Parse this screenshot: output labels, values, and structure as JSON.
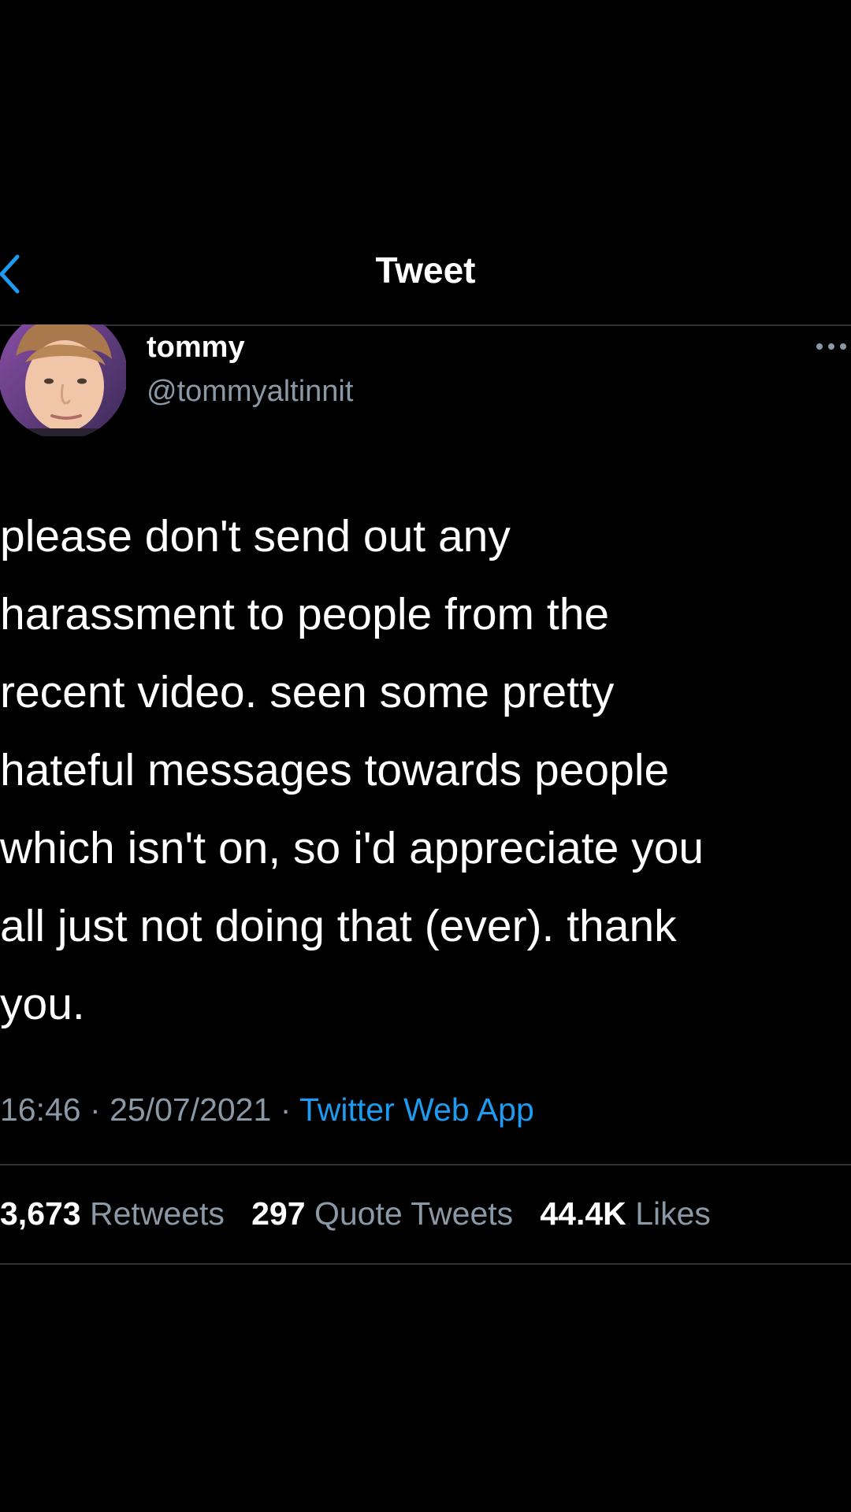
{
  "header": {
    "title": "Tweet",
    "back_icon": "chevron-left-icon",
    "accent_color": "#1d9bf0"
  },
  "author": {
    "display_name": "tommy",
    "handle": "@tommyaltinnit"
  },
  "tweet": {
    "text": "please don't send out any\nharassment to people from the\nrecent video. seen some pretty\nhateful messages towards people\nwhich isn't on, so i'd appreciate you\nall just not doing that (ever). thank\nyou.",
    "time": "16:46",
    "date": "25/07/2021",
    "separator": "·",
    "source": "Twitter Web App"
  },
  "stats": {
    "retweets_count": "3,673",
    "retweets_label": "Retweets",
    "quotes_count": "297",
    "quotes_label": "Quote Tweets",
    "likes_count": "44.4K",
    "likes_label": "Likes"
  }
}
